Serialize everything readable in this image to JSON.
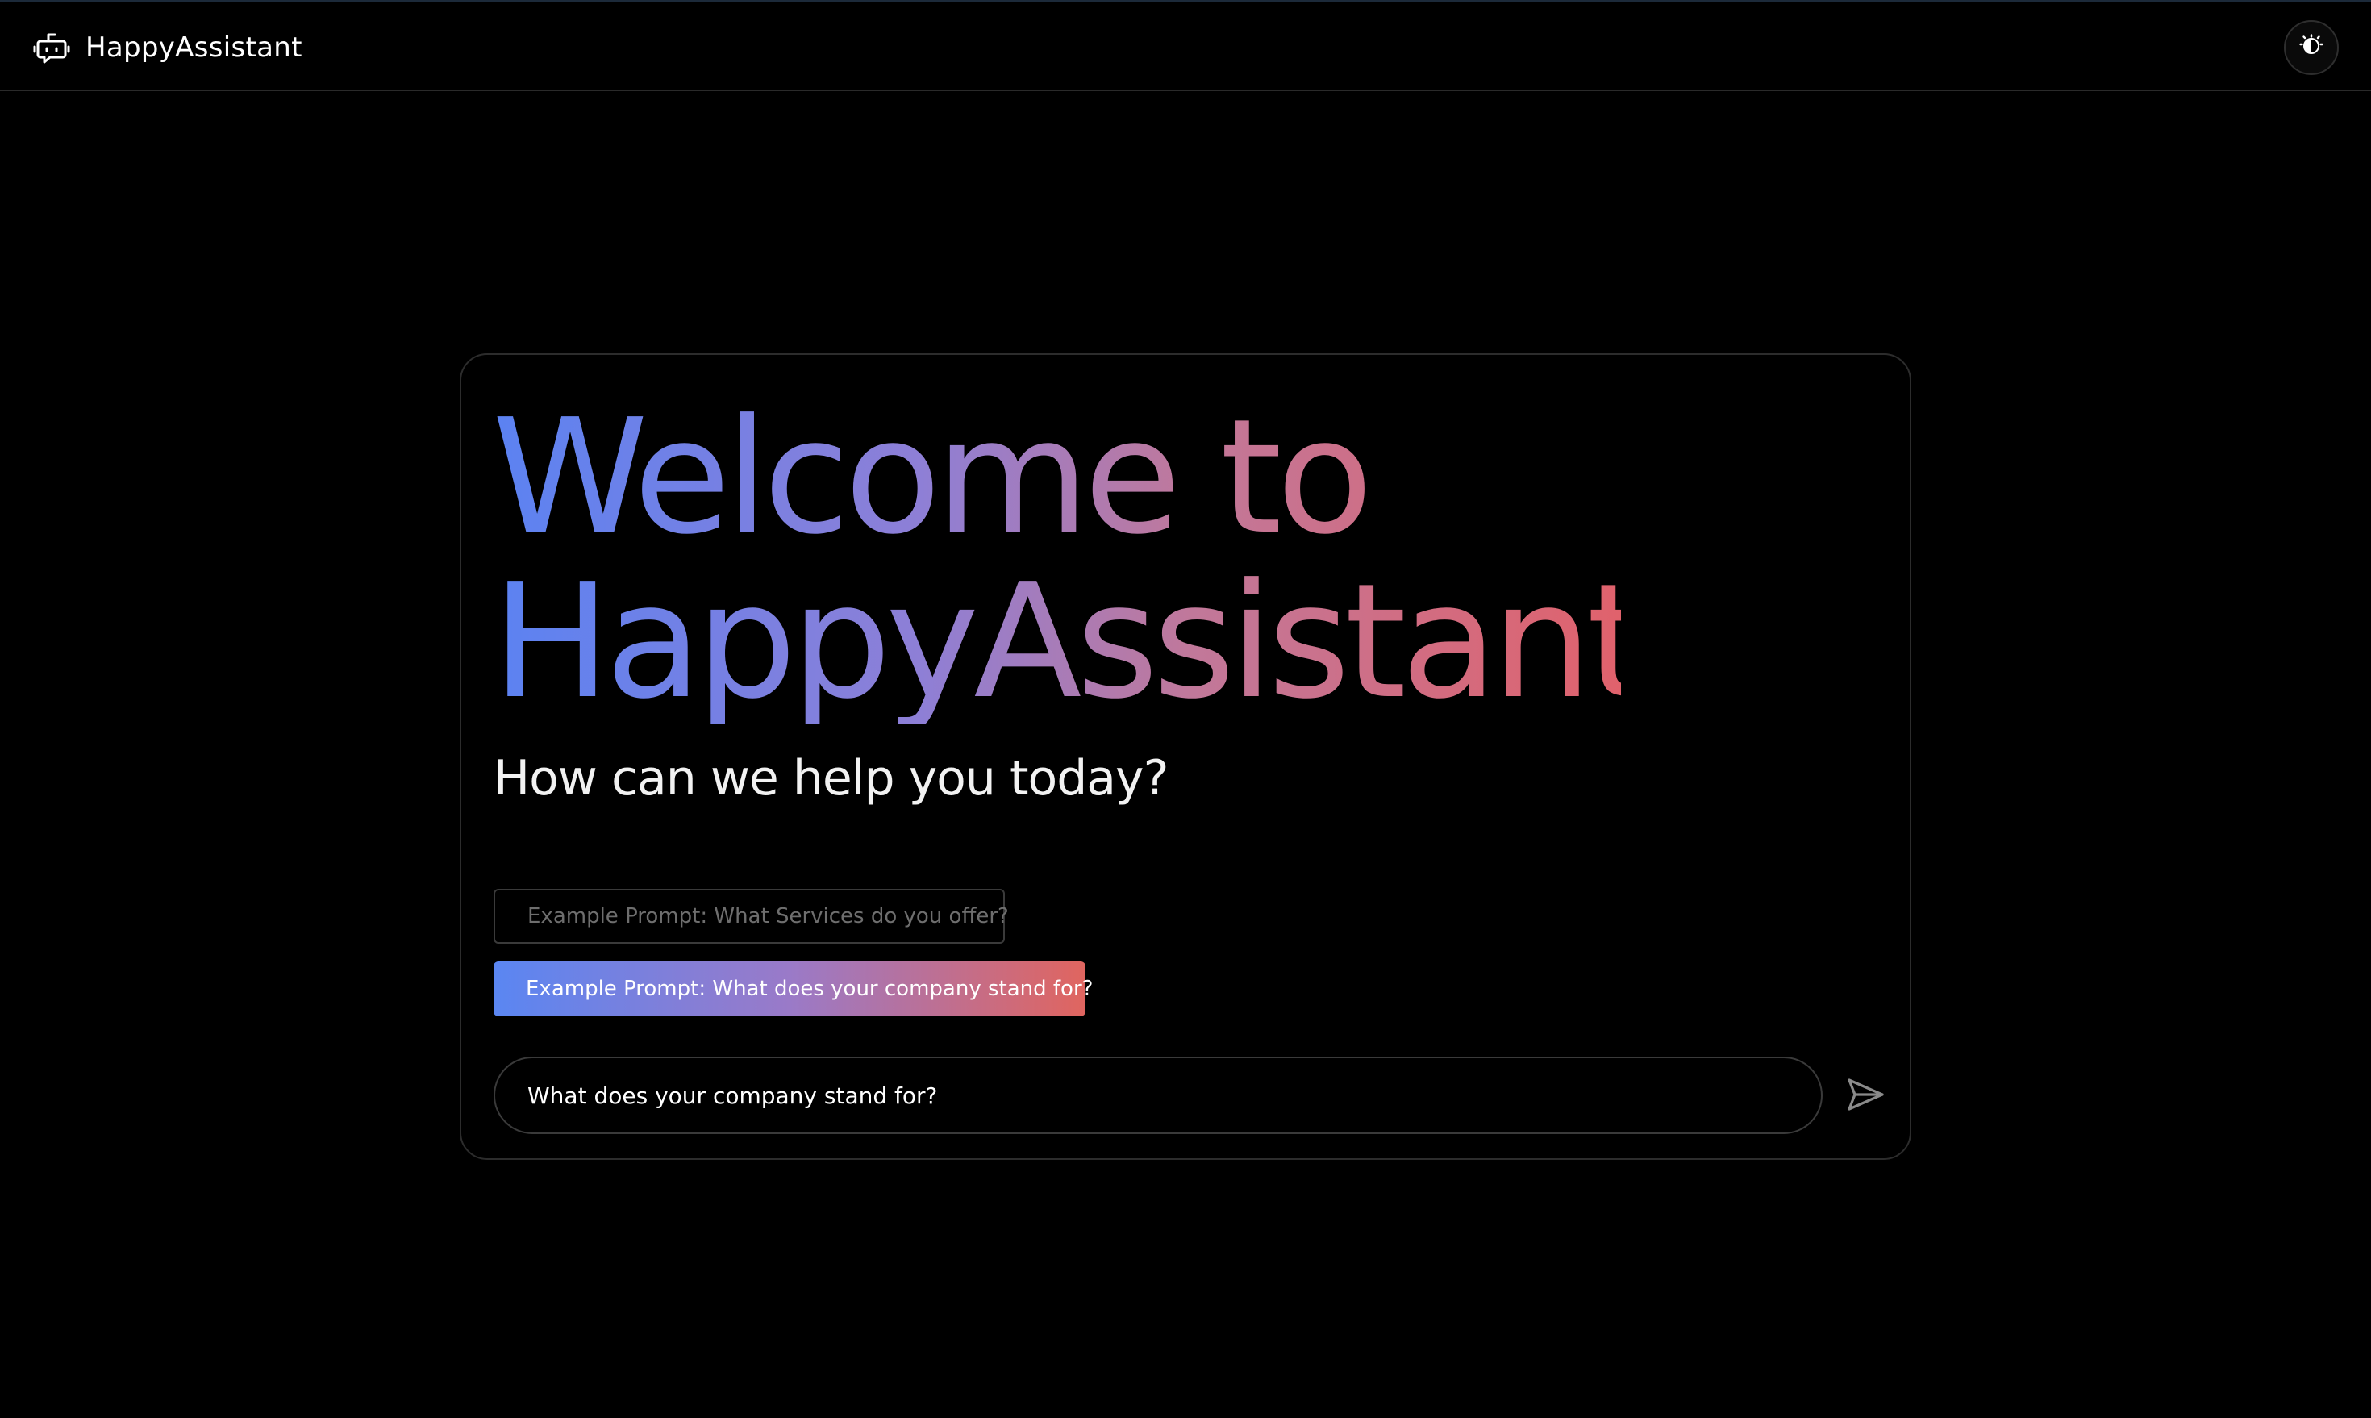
{
  "app": {
    "name": "HappyAssistant"
  },
  "header": {
    "logo_icon": "robot-icon",
    "theme_icon": "theme-toggle-icon"
  },
  "main": {
    "headline_line1": "Welcome to",
    "headline_line2": "HappyAssistant!",
    "subtitle": "How can we help you today?",
    "example_prompts": [
      "Example Prompt: What Services do you offer?",
      "Example Prompt: What does your company stand for?"
    ],
    "input_value": "What does your company stand for?",
    "send_icon": "send-icon"
  },
  "colors": {
    "background": "#000000",
    "gradient_start": "#5b82f2",
    "gradient_mid": "#9a7ac8",
    "gradient_end": "#e0626c",
    "border": "#2c2c2c"
  }
}
